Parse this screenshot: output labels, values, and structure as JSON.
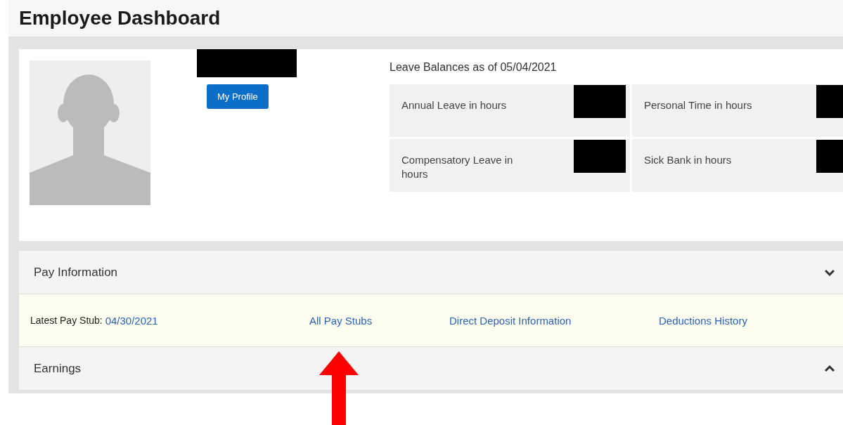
{
  "page": {
    "title": "Employee Dashboard"
  },
  "profile": {
    "name_redacted": true,
    "button": "My Profile"
  },
  "leave_balances": {
    "heading": "Leave Balances as of 05/04/2021",
    "items": [
      {
        "label": "Annual Leave in hours",
        "value_redacted": true
      },
      {
        "label": "Personal Time in hours",
        "value_redacted": true
      },
      {
        "label": "Compensatory Leave in hours",
        "value_redacted": true
      },
      {
        "label": "Sick Bank in hours",
        "value_redacted": true
      }
    ]
  },
  "sections": [
    {
      "title": "Pay Information",
      "expanded": true,
      "links": [
        {
          "kind": "labeled",
          "label": "Latest Pay Stub:",
          "text": "04/30/2021"
        },
        {
          "kind": "link",
          "text": "All Pay Stubs"
        },
        {
          "kind": "link",
          "text": "Direct Deposit Information"
        },
        {
          "kind": "link",
          "text": "Deductions History"
        }
      ]
    },
    {
      "title": "Earnings",
      "expanded": false
    }
  ],
  "annotation": {
    "kind": "arrow",
    "color": "#ff0000"
  }
}
